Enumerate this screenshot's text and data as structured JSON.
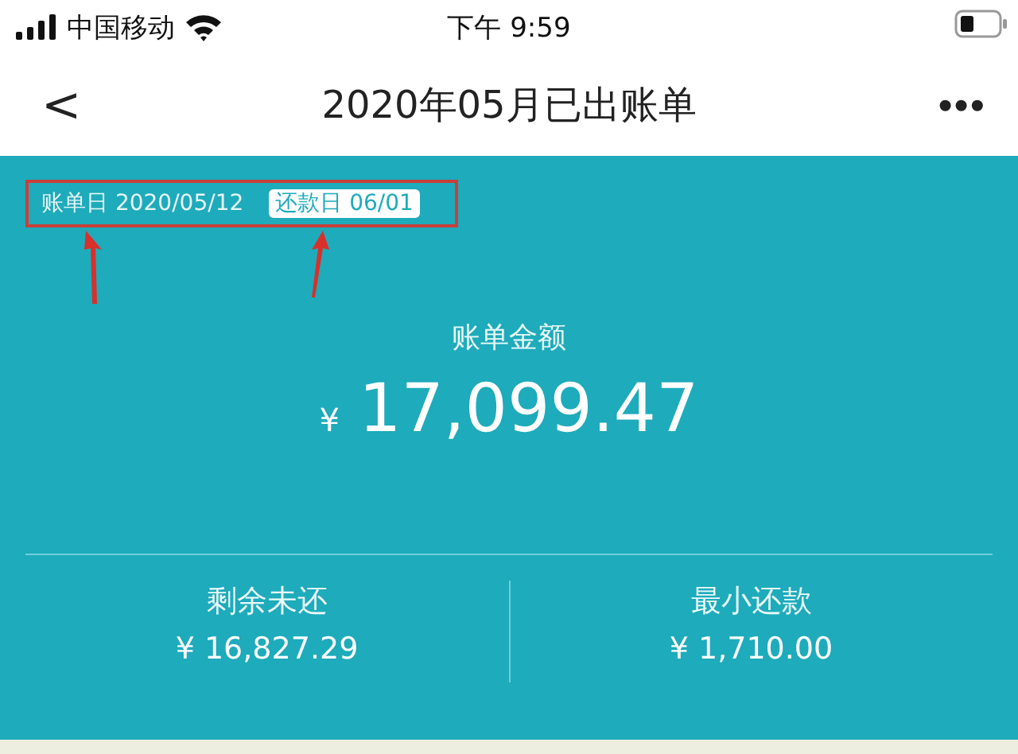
{
  "status_bar": {
    "carrier": "中国移动",
    "time": "下午 9:59"
  },
  "nav": {
    "back": "<",
    "title": "2020年05月已出账单",
    "more": "•••"
  },
  "bill": {
    "bill_date_label": "账单日 2020/05/12",
    "due_date_badge": "还款日 06/01",
    "amount_label": "账单金额",
    "currency": "¥",
    "amount": "17,099.47",
    "stats": [
      {
        "label": "剩余未还",
        "value": "¥ 16,827.29"
      },
      {
        "label": "最小还款",
        "value": "¥ 1,710.00"
      }
    ]
  }
}
